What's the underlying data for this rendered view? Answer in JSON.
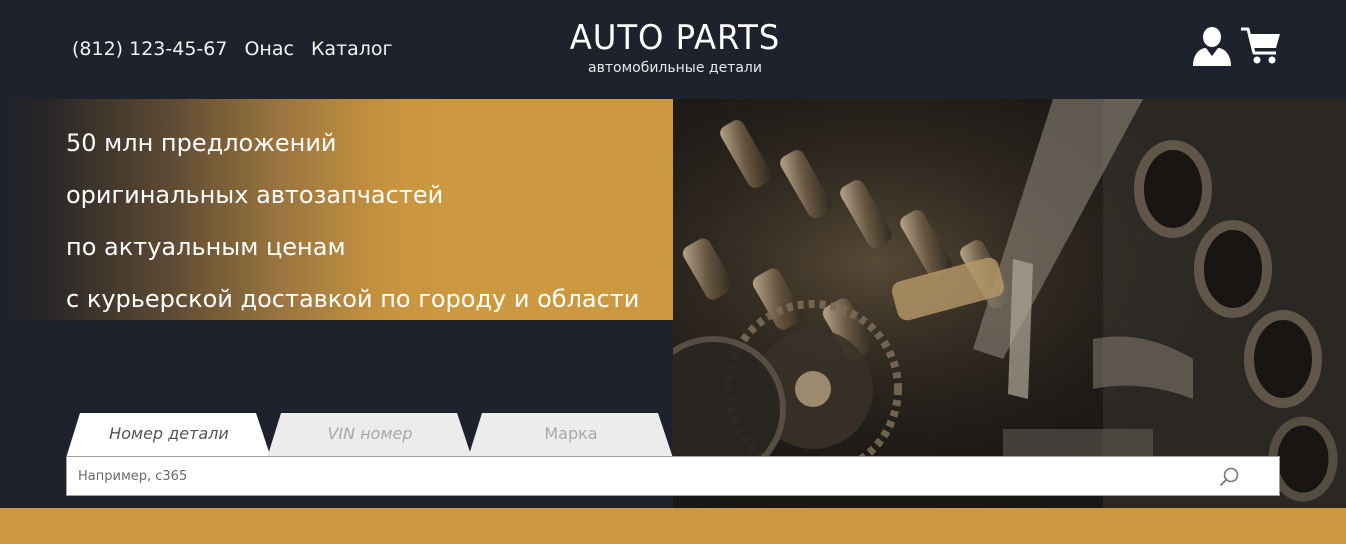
{
  "header": {
    "phone": "(812) 123-45-67",
    "nav": [
      "Онас",
      "Каталог"
    ],
    "logo_title": "AUTO PARTS",
    "logo_subtitle": "автомобильные детали"
  },
  "promo": {
    "lines": [
      "50 млн предложений",
      "оригинальных автозапчастей",
      "по актуальным ценам",
      "с курьерской доставкой по городу и области"
    ]
  },
  "search": {
    "tabs": [
      {
        "label": "Номер детали",
        "active": true
      },
      {
        "label": "VIN номер",
        "active": false
      },
      {
        "label": "Марка",
        "active": false
      }
    ],
    "placeholder": "Например, c365"
  },
  "colors": {
    "background": "#1e222c",
    "accent": "#cd9940",
    "white": "#ffffff"
  },
  "icons": [
    "user-icon",
    "cart-icon",
    "search-icon"
  ]
}
